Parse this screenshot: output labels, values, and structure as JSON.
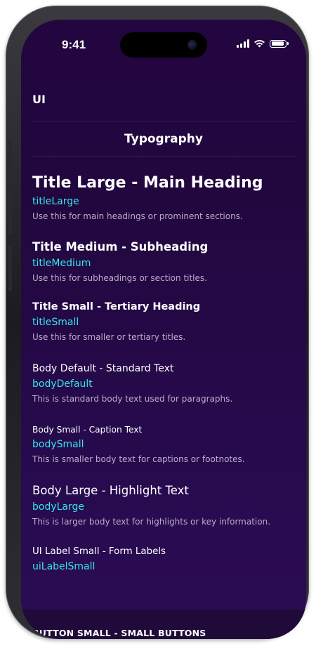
{
  "status_bar": {
    "time": "9:41"
  },
  "app": {
    "label": "UI",
    "page_title": "Typography"
  },
  "typography": [
    {
      "title": "Title Large - Main Heading",
      "token": "titleLarge",
      "description": "Use this for main headings or prominent sections."
    },
    {
      "title": "Title Medium - Subheading",
      "token": "titleMedium",
      "description": "Use this for subheadings or section titles."
    },
    {
      "title": "Title Small - Tertiary Heading",
      "token": "titleSmall",
      "description": "Use this for smaller or tertiary titles."
    },
    {
      "title": "Body Default - Standard Text",
      "token": "bodyDefault",
      "description": "This is standard body text used for paragraphs."
    },
    {
      "title": "Body Small - Caption Text",
      "token": "bodySmall",
      "description": "This is smaller body text for captions or footnotes."
    },
    {
      "title": "Body Large - Highlight Text",
      "token": "bodyLarge",
      "description": "This is larger body text for highlights or key information."
    },
    {
      "title": "UI Label Small - Form Labels",
      "token": "uiLabelSmall"
    },
    {
      "title": "BUTTON SMALL - SMALL BUTTONS"
    }
  ],
  "colors": {
    "background": "#23063f",
    "token_accent": "#33e6ec",
    "description_text": "#b9aec9",
    "title_text": "#ffffff"
  }
}
